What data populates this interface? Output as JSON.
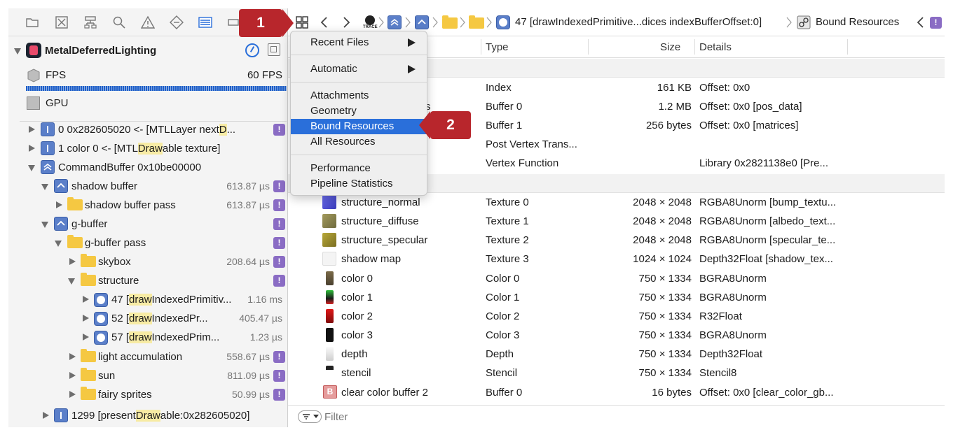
{
  "toolbar": {
    "icons": [
      "folder-icon",
      "x-box-icon",
      "hierarchy-icon",
      "search-icon",
      "warning-icon",
      "diamond-icon",
      "list-icon",
      "rect-icon"
    ]
  },
  "nav": {
    "crumb_text": "47 [drawIndexedPrimitive...dices indexBufferOffset:0]",
    "bound": "Bound Resources",
    "trace": "TRACE"
  },
  "sidebar": {
    "app": "MetalDeferredLighting",
    "fps_label": "FPS",
    "fps_value": "60 FPS",
    "gpu_label": "GPU",
    "rows": {
      "r0a": "0 0x282605020 <- [MTLLayer next",
      "r0b": "D",
      "r0c": "...",
      "r1a": "1 color 0 <- [MTL",
      "r1b": "Draw",
      "r1c": "able texture]",
      "r2": "CommandBuffer 0x10be00000",
      "r3": "shadow buffer",
      "r3t": "613.87 µs",
      "r4": "shadow buffer pass",
      "r4t": "613.87 µs",
      "r5": "g-buffer",
      "r6": "g-buffer pass",
      "r7": "skybox",
      "r7t": "208.64 µs",
      "r8": "structure",
      "r9a": "47 [",
      "r9b": "draw",
      "r9c": "IndexedPrimitiv...",
      "r9t": "1.16 ms",
      "r10a": "52 [",
      "r10b": "draw",
      "r10c": "IndexedPr...",
      "r10t": "405.47 µs",
      "r11a": "57 [",
      "r11b": "draw",
      "r11c": "IndexedPrim...",
      "r11t": "1.23 µs",
      "r12": "light accumulation",
      "r12t": "558.67 µs",
      "r13": "sun",
      "r13t": "811.09 µs",
      "r14": "fairy sprites",
      "r14t": "50.99 µs",
      "r15a": "1299 [present",
      "r15b": "Draw",
      "r15c": "able:0x282605020]"
    },
    "badge": "!"
  },
  "table": {
    "headers": {
      "type": "Type",
      "size": "Size",
      "details": "Details"
    },
    "rows": [
      {
        "name": "",
        "type": "Index",
        "size": "161 KB",
        "details": "Offset: 0x0"
      },
      {
        "name": "s",
        "type": "Buffer 0",
        "size": "1.2 MB",
        "details": "Offset: 0x0 [pos_data]"
      },
      {
        "name": "",
        "type": "Buffer 1",
        "size": "256 bytes",
        "details": "Offset: 0x0 [matrices]"
      },
      {
        "name": "",
        "type": "Post Vertex Trans...",
        "size": "",
        "details": ""
      },
      {
        "name": "",
        "type": "Vertex Function",
        "size": "",
        "details": "Library 0x2821138e0 [Pre..."
      },
      {
        "name": "structure_normal",
        "type": "Texture 0",
        "size": "2048 × 2048",
        "details": "RGBA8Unorm [bump_textu..."
      },
      {
        "name": "structure_diffuse",
        "type": "Texture 1",
        "size": "2048 × 2048",
        "details": "RGBA8Unorm [albedo_text..."
      },
      {
        "name": "structure_specular",
        "type": "Texture 2",
        "size": "2048 × 2048",
        "details": "RGBA8Unorm [specular_te..."
      },
      {
        "name": "shadow map",
        "type": "Texture 3",
        "size": "1024 × 1024",
        "details": "Depth32Float [shadow_tex..."
      },
      {
        "name": "color 0",
        "type": "Color 0",
        "size": "750 × 1334",
        "details": "BGRA8Unorm"
      },
      {
        "name": "color 1",
        "type": "Color 1",
        "size": "750 × 1334",
        "details": "BGRA8Unorm"
      },
      {
        "name": "color 2",
        "type": "Color 2",
        "size": "750 × 1334",
        "details": "R32Float"
      },
      {
        "name": "color 3",
        "type": "Color 3",
        "size": "750 × 1334",
        "details": "BGRA8Unorm"
      },
      {
        "name": "depth",
        "type": "Depth",
        "size": "750 × 1334",
        "details": "Depth32Float"
      },
      {
        "name": "stencil",
        "type": "Stencil",
        "size": "750 × 1334",
        "details": "Stencil8"
      },
      {
        "name": "clear color buffer 2",
        "type": "Buffer 0",
        "size": "16 bytes",
        "details": "Offset: 0x0 [clear_color_gb..."
      }
    ],
    "buffer_glyph": "B"
  },
  "filter": {
    "placeholder": "Filter"
  },
  "menu": {
    "recent": "Recent Files",
    "automatic": "Automatic",
    "attachments": "Attachments",
    "geometry": "Geometry",
    "bound": "Bound Resources",
    "all": "All Resources",
    "performance": "Performance",
    "pipeline": "Pipeline Statistics"
  },
  "callouts": {
    "one": "1",
    "two": "2"
  }
}
